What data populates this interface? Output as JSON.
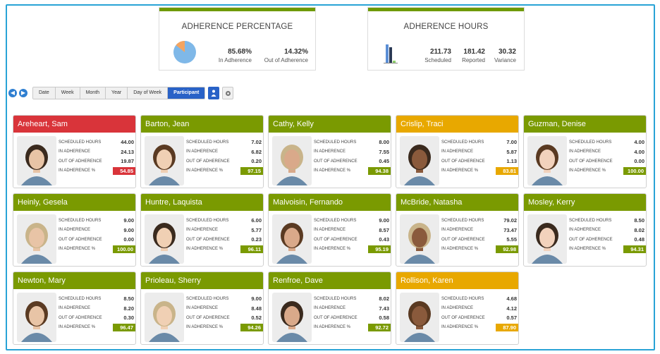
{
  "adherence_percentage": {
    "title": "ADHERENCE PERCENTAGE",
    "in_value": "85.68%",
    "in_label": "In Adherence",
    "out_value": "14.32%",
    "out_label": "Out of Adherence",
    "in_fraction": 0.8568
  },
  "adherence_hours": {
    "title": "ADHERENCE HOURS",
    "scheduled_value": "211.73",
    "scheduled_label": "Scheduled",
    "reported_value": "181.42",
    "reported_label": "Reported",
    "variance_value": "30.32",
    "variance_label": "Variance"
  },
  "toolbar": {
    "tabs": [
      "Date",
      "Week",
      "Month",
      "Year",
      "Day of Week",
      "Participant"
    ],
    "active_tab": "Participant"
  },
  "labels": {
    "scheduled": "SCHEDULED HOURS",
    "in": "IN ADHERENCE",
    "out": "OUT OF ADHERENCE",
    "pct": "IN ADHERENCE %"
  },
  "colors": {
    "green": "#7a9a01",
    "red": "#d9343a",
    "amber": "#e8a800",
    "accent_blue": "#2962c7"
  },
  "participants": [
    {
      "name": "Areheart, Sam",
      "scheduled": "44.00",
      "in": "24.13",
      "out": "19.87",
      "pct": "54.85",
      "status": "red"
    },
    {
      "name": "Barton, Jean",
      "scheduled": "7.02",
      "in": "6.82",
      "out": "0.20",
      "pct": "97.15",
      "status": "green"
    },
    {
      "name": "Cathy, Kelly",
      "scheduled": "8.00",
      "in": "7.55",
      "out": "0.45",
      "pct": "94.38",
      "status": "green"
    },
    {
      "name": "Crislip, Traci",
      "scheduled": "7.00",
      "in": "5.87",
      "out": "1.13",
      "pct": "83.81",
      "status": "amber"
    },
    {
      "name": "Guzman, Denise",
      "scheduled": "4.00",
      "in": "4.00",
      "out": "0.00",
      "pct": "100.00",
      "status": "green"
    },
    {
      "name": "Heinly, Gesela",
      "scheduled": "9.00",
      "in": "9.00",
      "out": "0.00",
      "pct": "100.00",
      "status": "green"
    },
    {
      "name": "Huntre, Laquista",
      "scheduled": "6.00",
      "in": "5.77",
      "out": "0.23",
      "pct": "96.11",
      "status": "green"
    },
    {
      "name": "Malvoisin, Fernando",
      "scheduled": "9.00",
      "in": "8.57",
      "out": "0.43",
      "pct": "95.19",
      "status": "green"
    },
    {
      "name": "McBride, Natasha",
      "scheduled": "79.02",
      "in": "73.47",
      "out": "5.55",
      "pct": "92.98",
      "status": "green"
    },
    {
      "name": "Mosley, Kerry",
      "scheduled": "8.50",
      "in": "8.02",
      "out": "0.48",
      "pct": "94.31",
      "status": "green"
    },
    {
      "name": "Newton, Mary",
      "scheduled": "8.50",
      "in": "8.20",
      "out": "0.30",
      "pct": "96.47",
      "status": "green"
    },
    {
      "name": "Prioleau, Sherry",
      "scheduled": "9.00",
      "in": "8.48",
      "out": "0.52",
      "pct": "94.26",
      "status": "green"
    },
    {
      "name": "Renfroe, Dave",
      "scheduled": "8.02",
      "in": "7.43",
      "out": "0.58",
      "pct": "92.72",
      "status": "green"
    },
    {
      "name": "Rollison, Karen",
      "scheduled": "4.68",
      "in": "4.12",
      "out": "0.57",
      "pct": "87.90",
      "status": "amber"
    }
  ]
}
